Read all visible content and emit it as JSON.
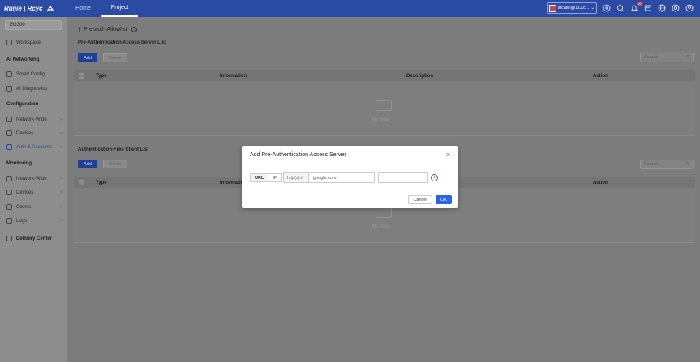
{
  "header": {
    "logo_text": "Ruijie | Rcyc",
    "nav": [
      "Home",
      "Project"
    ],
    "active_nav": "Project",
    "account_label": "alcatel@111.c...",
    "notification_count": "10"
  },
  "sidebar": {
    "site": "EG300",
    "workspace": "Workspace",
    "sections": {
      "ai_networking": "AI Networking",
      "configuration": "Configuration",
      "monitoring": "Monitoring"
    },
    "items": {
      "smart_config": "Smart Config",
      "ai_diagnostics": "AI Diagnostics",
      "network_wide_cfg": "Network-Wide",
      "devices_cfg": "Devices",
      "auth_accounts": "Auth & Accounts",
      "network_wide_mon": "Network-Wide",
      "devices_mon": "Devices",
      "clients": "Clients",
      "logs": "Logs",
      "delivery_center": "Delivery Center"
    }
  },
  "main": {
    "page_title": "Pre-auth Allowlist",
    "section1_title": "Pre-Authentication Access Server List",
    "section2_title": "Authentication-Free Client List",
    "add_label": "Add",
    "delete_label": "Delete",
    "search_placeholder": "Search",
    "columns1": [
      "Type",
      "Information",
      "Description",
      "Action"
    ],
    "columns2": [
      "Type",
      "Information",
      "Action"
    ],
    "empty_text": "No Data"
  },
  "modal": {
    "title": "Add Pre-Authentication Access Server",
    "seg_url": "URL",
    "seg_ip": "IP",
    "url_prefix": "http(s)://",
    "url_value": "google.com",
    "cancel_label": "Cancel",
    "ok_label": "OK"
  },
  "colors": {
    "brand": "#2b4aa3",
    "primary_button": "#2a63e6"
  }
}
